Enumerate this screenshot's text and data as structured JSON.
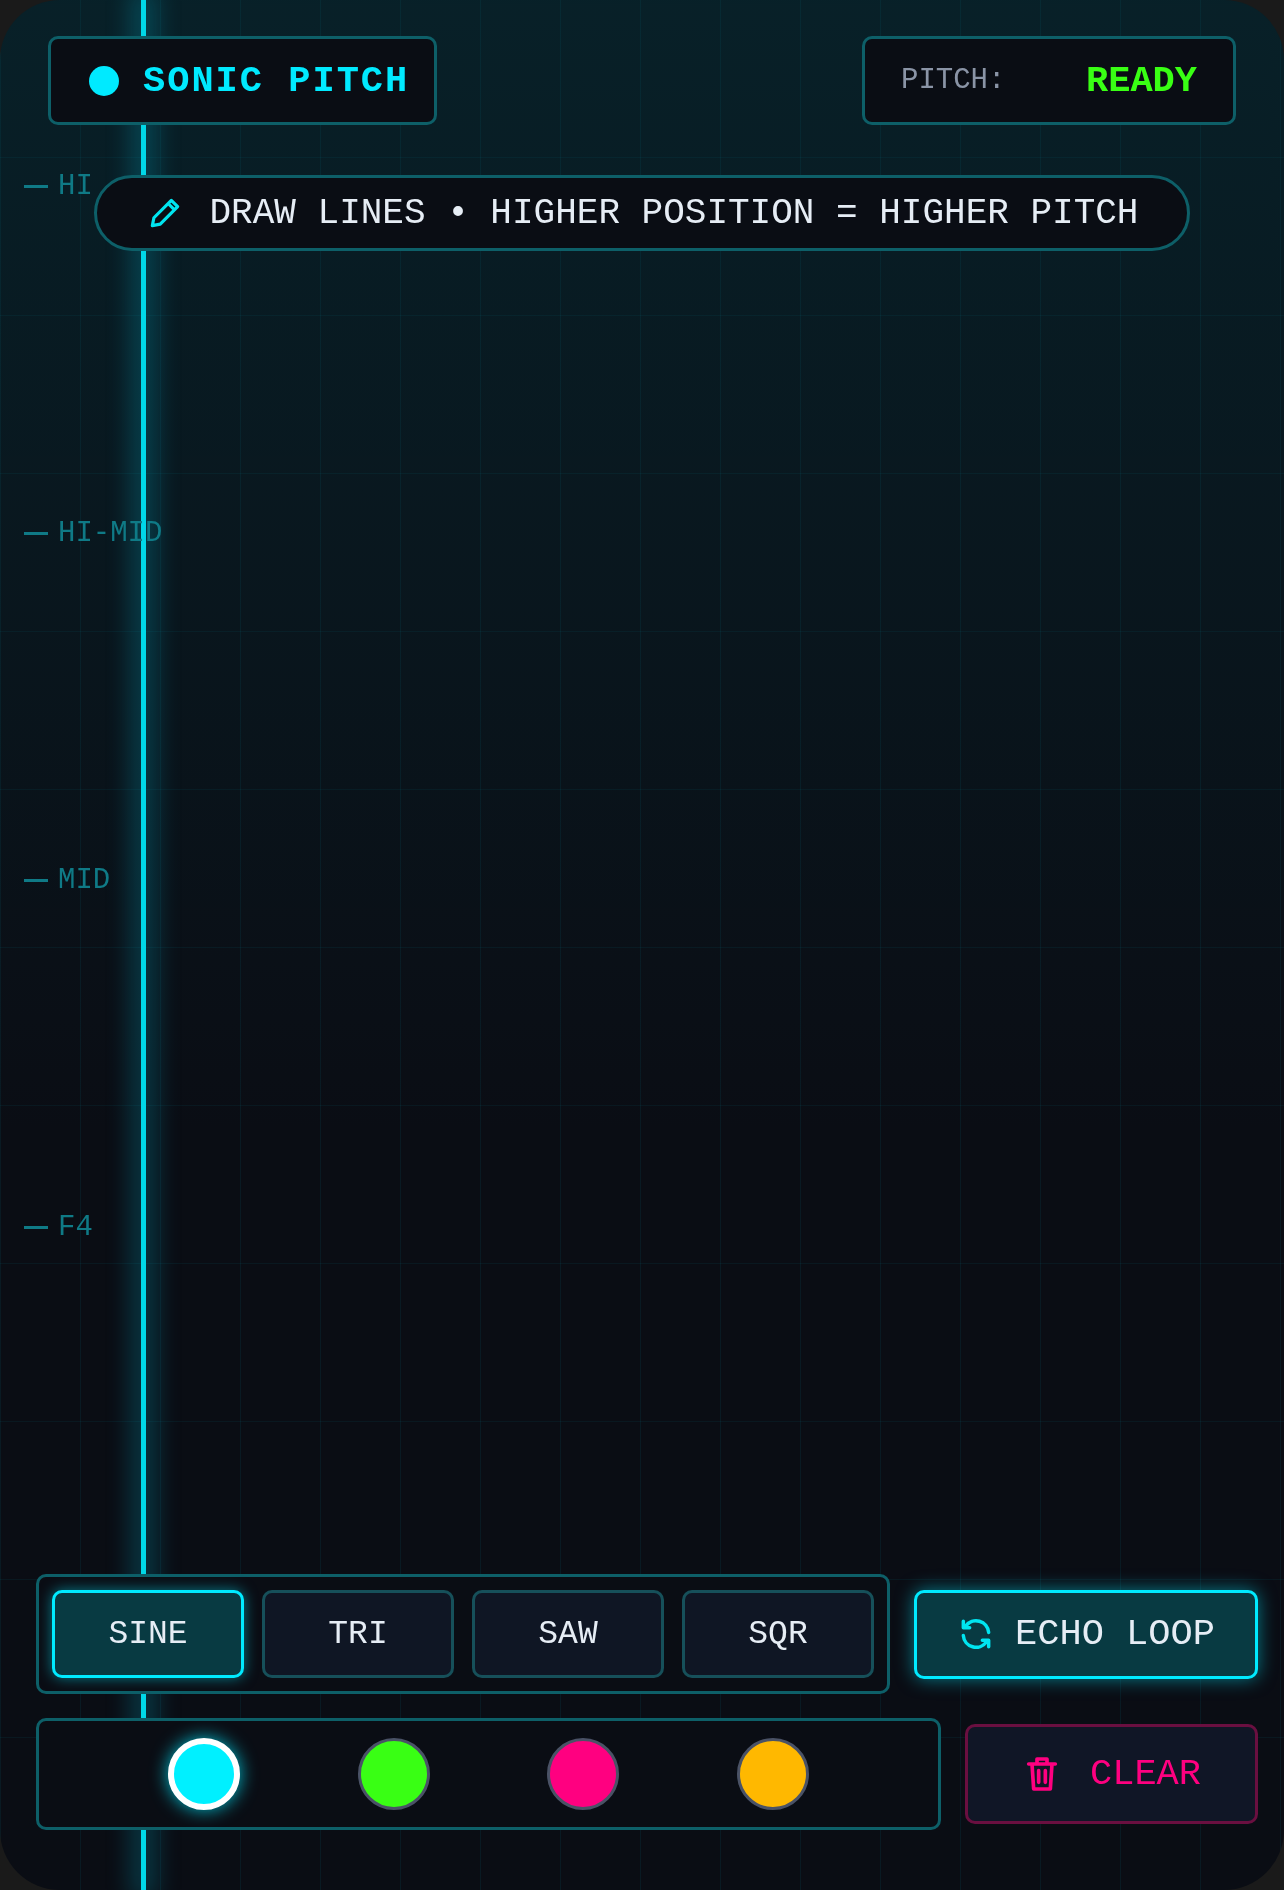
{
  "brand": {
    "name": "SONIC PITCH"
  },
  "status": {
    "label": "PITCH:",
    "value": "READY"
  },
  "hint": "DRAW LINES • HIGHER POSITION = HIGHER PITCH",
  "pitch_labels": [
    "HI",
    "HI-MID",
    "MID",
    "F4"
  ],
  "waveforms": [
    {
      "label": "SINE",
      "selected": true
    },
    {
      "label": "TRI",
      "selected": false
    },
    {
      "label": "SAW",
      "selected": false
    },
    {
      "label": "SQR",
      "selected": false
    }
  ],
  "echo_loop": {
    "label": "ECHO LOOP",
    "on": true
  },
  "colors": [
    {
      "color": "#00f0ff",
      "selected": true
    },
    {
      "color": "#39ff14",
      "selected": false
    },
    {
      "color": "#ff0080",
      "selected": false
    },
    {
      "color": "#ffb800",
      "selected": false
    }
  ],
  "clear_button": "CLEAR"
}
